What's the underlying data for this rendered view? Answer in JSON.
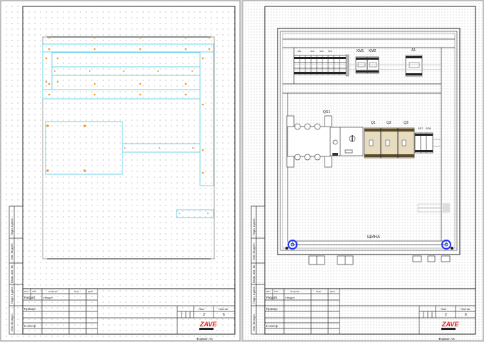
{
  "sheets": [
    {
      "side_labels": [
        "Подп. и дата",
        "Инв. № дубл.",
        "Взам. инв. №",
        "Подп. и дата",
        "Инв. № подл."
      ],
      "title_block": {
        "col_headers": [
          "Изм.",
          "Лист",
          "№ докум.",
          "Подп.",
          "Дата"
        ],
        "developed_label": "Разраб.",
        "developer": "Нешрн",
        "checked_label": "Провер.",
        "norm_control_label": "Н.контр.",
        "sheet_label": "Лист",
        "sheets_label": "Листов",
        "sheet_number": "3",
        "sheets_total": "6"
      },
      "logo": "ZAVE",
      "format_label": "Формат А4"
    },
    {
      "side_labels": [
        "Подп. и дата",
        "Инв. № дубл.",
        "Взам. инв. №",
        "Подп. и дата",
        "Инв. № подл."
      ],
      "title_block": {
        "col_headers": [
          "Изм.",
          "Лист",
          "№ докум.",
          "Подп.",
          "Дата"
        ],
        "developed_label": "Разраб.",
        "developer": "Нешрн",
        "checked_label": "Провер.",
        "norm_control_label": "Н.контр.",
        "sheet_label": "Лист",
        "sheets_label": "Листов",
        "sheet_number": "2",
        "sheets_total": "6"
      },
      "logo": "ZAVE",
      "format_label": "Формат А4"
    }
  ],
  "panel": {
    "labels": {
      "sf1": "SF1",
      "sf2": "SF2",
      "sf3": "SF3",
      "sf4": "SF4",
      "km1": "KM1",
      "km2": "KM2",
      "a1": "A1",
      "qs1": "QS1",
      "q1": "Q1",
      "q2": "Q2",
      "q3": "Q3",
      "sf7": "SF7",
      "sf8": "SF8",
      "bus": "ШИНА"
    }
  },
  "colors": {
    "layout_lines": "#6fd3ea",
    "fastener_points": "#f59a2a",
    "bus_terminals": "#2233ee",
    "logo": "#e02020"
  }
}
